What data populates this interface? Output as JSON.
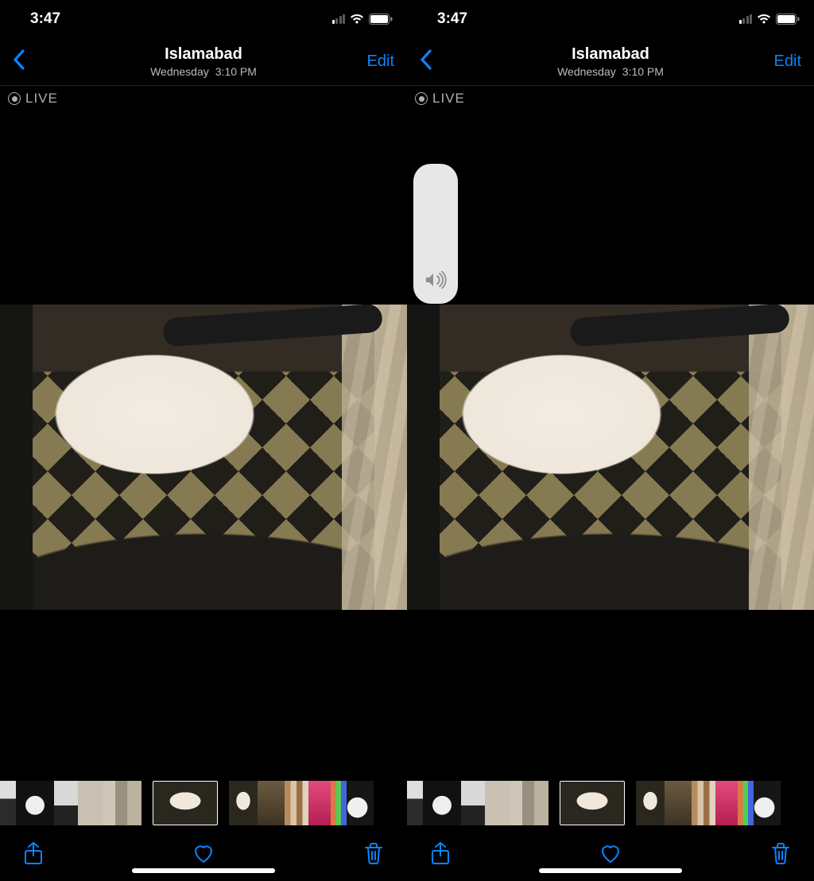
{
  "colors": {
    "accent": "#0a84ff",
    "muted": "#b0b0b0"
  },
  "screens": [
    {
      "status": {
        "time": "3:47"
      },
      "header": {
        "location": "Islamabad",
        "day": "Wednesday",
        "time": "3:10 PM",
        "edit_label": "Edit"
      },
      "live_label": "LIVE",
      "show_volume_hud": false
    },
    {
      "status": {
        "time": "3:47"
      },
      "header": {
        "location": "Islamabad",
        "day": "Wednesday",
        "time": "3:10 PM",
        "edit_label": "Edit"
      },
      "live_label": "LIVE",
      "show_volume_hud": true
    }
  ],
  "icons": {
    "back": "chevron-left-icon",
    "share": "share-icon",
    "heart": "heart-icon",
    "trash": "trash-icon",
    "live": "live-photo-icon",
    "speaker": "speaker-icon",
    "cellular": "cellular-icon",
    "wifi": "wifi-icon",
    "battery": "battery-icon"
  }
}
